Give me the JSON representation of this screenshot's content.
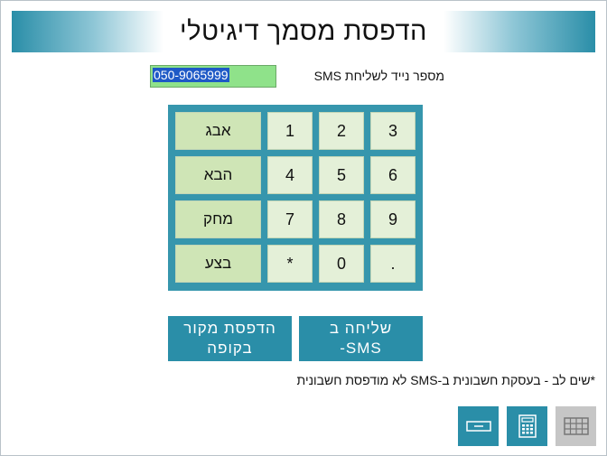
{
  "header": {
    "title": "הדפסת מסמך דיגיטלי"
  },
  "phone": {
    "label": "מספר נייד לשליחת SMS",
    "value": "050-9065999"
  },
  "keypad": {
    "rows": [
      {
        "action": "אבג",
        "keys": [
          "1",
          "2",
          "3"
        ]
      },
      {
        "action": "הבא",
        "keys": [
          "4",
          "5",
          "6"
        ]
      },
      {
        "action": "מחק",
        "keys": [
          "7",
          "8",
          "9"
        ]
      },
      {
        "action": "בצע",
        "keys": [
          "*",
          "0",
          "."
        ]
      }
    ]
  },
  "buttons": {
    "print_original": {
      "line1": "הדפסת מקור",
      "line2": "בקופה"
    },
    "send_sms": {
      "line1": "שליחה ב",
      "line2": "SMS-"
    }
  },
  "note": "*שים לב - בעסקת חשבונית ב-SMS לא מודפסת חשבונית",
  "toolbar": {
    "icons": [
      "keyboard-field-icon",
      "calculator-icon",
      "grid-keyboard-icon"
    ]
  },
  "colors": {
    "accent": "#2a8ea8",
    "key_bg": "#e4f0d8",
    "action_key_bg": "#cfe5b6",
    "input_bg": "#8fe28a",
    "selection": "#1e59c6"
  }
}
